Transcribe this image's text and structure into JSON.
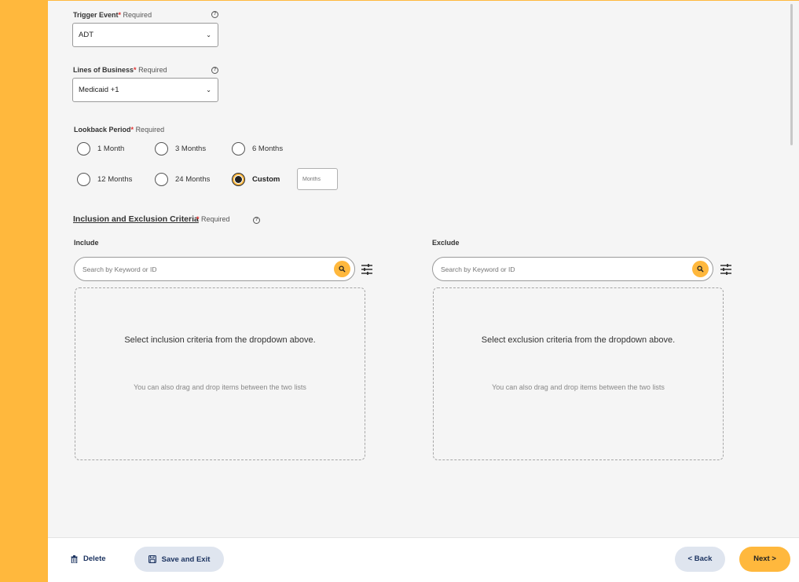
{
  "trigger_event": {
    "label": "Trigger Event",
    "required_star": "*",
    "required_text": "Required",
    "help": "?",
    "value": "ADT"
  },
  "lines_of_business": {
    "label": "Lines of Business",
    "required_star": "*",
    "required_text": "Required",
    "help": "?",
    "value": "Medicaid +1"
  },
  "lookback": {
    "label": "Lookback Period",
    "required_star": "*",
    "required_text": "Required",
    "options": [
      "1 Month",
      "3 Months",
      "6 Months",
      "12 Months",
      "24 Months",
      "Custom"
    ],
    "selected": "Custom",
    "custom_placeholder": "Months"
  },
  "criteria": {
    "title": "Inclusion and Exclusion Criteria",
    "required_star": "*",
    "required_text": "Required",
    "help": "?",
    "include": {
      "label": "Include",
      "search_placeholder": "Search by Keyword or ID",
      "empty_primary": "Select inclusion criteria from the dropdown above.",
      "empty_secondary": "You can also drag and drop items between the two lists"
    },
    "exclude": {
      "label": "Exclude",
      "search_placeholder": "Search by Keyword or ID",
      "empty_primary": "Select exclusion criteria from the dropdown above.",
      "empty_secondary": "You can also drag and drop items between the two lists"
    }
  },
  "footer": {
    "delete_label": "Delete",
    "save_label": "Save and Exit",
    "back_label": "< Back",
    "next_label": "Next >"
  },
  "colors": {
    "accent": "#ffb83d",
    "navy": "#1d3461",
    "required": "#e0312f"
  }
}
